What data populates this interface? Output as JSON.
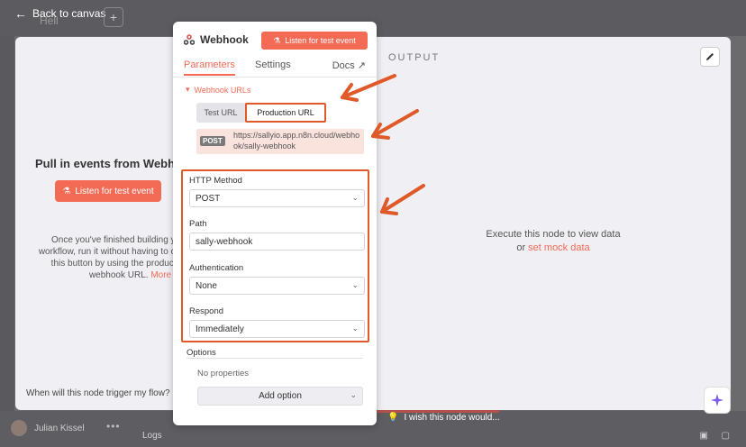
{
  "background": {
    "back_label": "Back to canvas",
    "workflow_name": "Hell",
    "plus_label": "+",
    "user_name": "Julian Kissel",
    "dots": "•••",
    "logs_label": "Logs",
    "wish_label": "I wish this node would...",
    "corner_icons": "▣ ▢"
  },
  "input_pane": {
    "title": "Pull in events from Webhook",
    "listen_button": "Listen for test event",
    "description": "Once you've finished building your workflow, run it without having to click this button by using the production webhook URL.",
    "more_info": "More info",
    "footer_question": "When will this node trigger my flow?"
  },
  "output_pane": {
    "label": "OUTPUT",
    "message": "Execute this node to view data",
    "or_text": "or",
    "mock_link": "set mock data"
  },
  "params": {
    "node_title": "Webhook",
    "listen_button": "Listen for test event",
    "tabs": [
      {
        "label": "Parameters",
        "active": true
      },
      {
        "label": "Settings",
        "active": false
      },
      {
        "label": "Docs",
        "active": false
      }
    ],
    "webhook_urls_label": "Webhook URLs",
    "url_tabs": {
      "test": "Test URL",
      "production": "Production URL"
    },
    "url_method": "POST",
    "url_value": "https://sallyio.app.n8n.cloud/webhook/sally-webhook",
    "fields": [
      {
        "label": "HTTP Method",
        "value": "POST",
        "type": "select"
      },
      {
        "label": "Path",
        "value": "sally-webhook",
        "type": "text"
      },
      {
        "label": "Authentication",
        "value": "None",
        "type": "select"
      },
      {
        "label": "Respond",
        "value": "Immediately",
        "type": "select"
      }
    ],
    "options_label": "Options",
    "no_properties": "No properties",
    "add_option": "Add option"
  },
  "colors": {
    "accent": "#f36a55",
    "annotation": "#e05a29"
  }
}
